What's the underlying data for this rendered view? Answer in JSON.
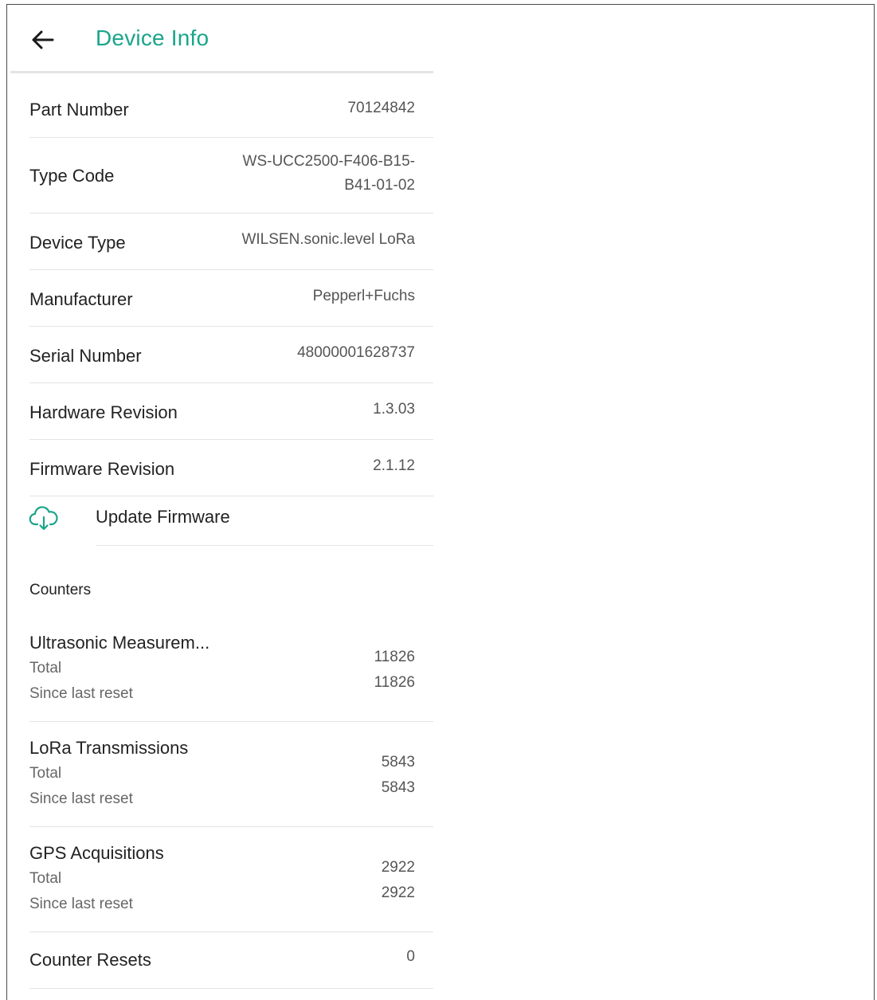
{
  "header": {
    "title": "Device Info"
  },
  "info_rows": [
    {
      "label": "Part Number",
      "value": "70124842"
    },
    {
      "label": "Type Code",
      "value_line1": "WS-UCC2500-F406-B15-",
      "value_line2": "B41-01-02"
    },
    {
      "label": "Device Type",
      "value": "WILSEN.sonic.level LoRa"
    },
    {
      "label": "Manufacturer",
      "value": "Pepperl+Fuchs"
    },
    {
      "label": "Serial Number",
      "value": "48000001628737"
    },
    {
      "label": "Hardware Revision",
      "value": "1.3.03"
    },
    {
      "label": "Firmware Revision",
      "value": "2.1.12"
    }
  ],
  "update": {
    "label": "Update Firmware"
  },
  "counters": {
    "section_title": "Counters",
    "items": [
      {
        "title": "Ultrasonic Measurem...",
        "total_label": "Total",
        "reset_label": "Since last reset",
        "total": "11826",
        "since_reset": "11826"
      },
      {
        "title": "LoRa Transmissions",
        "total_label": "Total",
        "reset_label": "Since last reset",
        "total": "5843",
        "since_reset": "5843"
      },
      {
        "title": "GPS Acquisitions",
        "total_label": "Total",
        "reset_label": "Since last reset",
        "total": "2922",
        "since_reset": "2922"
      }
    ],
    "resets": {
      "label": "Counter Resets",
      "value": "0"
    }
  },
  "colors": {
    "accent": "#1aa58a"
  }
}
